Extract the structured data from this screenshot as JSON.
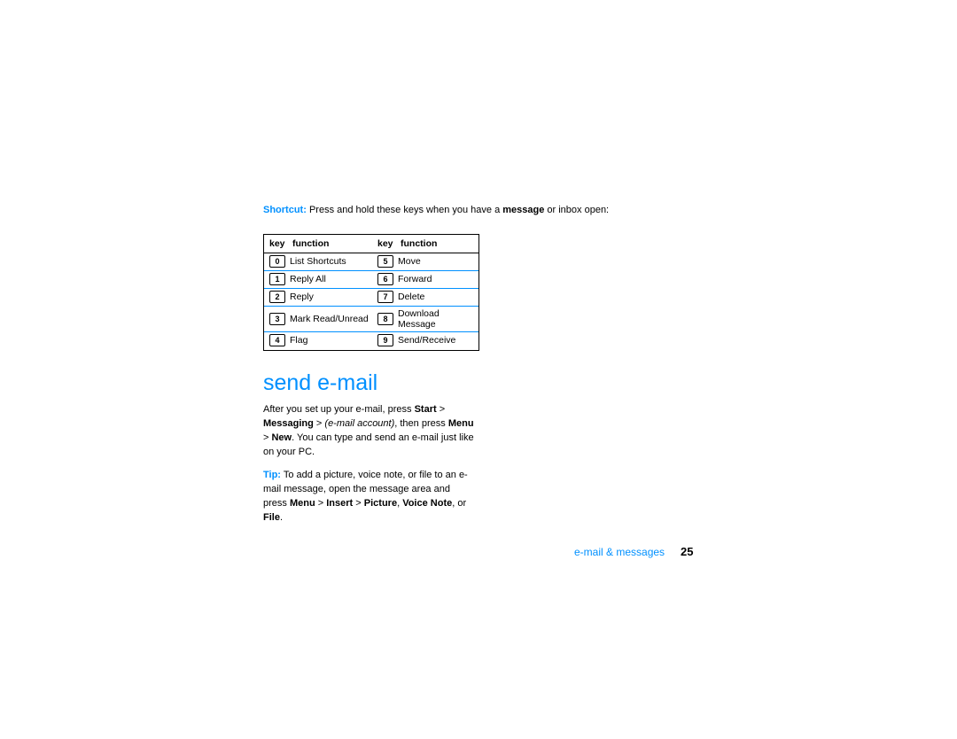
{
  "intro": {
    "shortcut_label": "Shortcut:",
    "shortcut_text": " Press and hold these keys when you have a ",
    "shortcut_bold": "message",
    "shortcut_tail": " or inbox open:"
  },
  "table": {
    "headers": {
      "key": "key",
      "function": "function"
    },
    "left": [
      {
        "k": "0",
        "f": "List Shortcuts"
      },
      {
        "k": "1",
        "f": "Reply All"
      },
      {
        "k": "2",
        "f": "Reply"
      },
      {
        "k": "3",
        "f": "Mark Read/Unread"
      },
      {
        "k": "4",
        "f": "Flag"
      }
    ],
    "right": [
      {
        "k": "5",
        "f": "Move"
      },
      {
        "k": "6",
        "f": "Forward"
      },
      {
        "k": "7",
        "f": "Delete"
      },
      {
        "k": "8",
        "f": "Download Message"
      },
      {
        "k": "9",
        "f": "Send/Receive"
      }
    ]
  },
  "heading": "send e-mail",
  "para1": {
    "t1": "After you set up your e-mail, press ",
    "nav1": "Start",
    "gt1": " > ",
    "nav2": "Messaging",
    "t2": " > ",
    "it": "(e-mail account)",
    "t3": ", then press ",
    "nav3": "Menu",
    "gt2": " > ",
    "nav4": "New",
    "t4": ". You can type and send an e-mail just like on your PC."
  },
  "para2": {
    "tip_label": "Tip:",
    "t1": " To add a picture, voice note, or file to an e-mail message, open the message area and press ",
    "nav1": "Menu",
    "gt1": " > ",
    "nav2": "Insert",
    "gt2": " > ",
    "nav3": "Picture",
    "c1": ", ",
    "nav4": "Voice Note",
    "c2": ", or ",
    "nav5": "File",
    "t2": "."
  },
  "footer": {
    "section": "e-mail & messages",
    "page": "25"
  }
}
